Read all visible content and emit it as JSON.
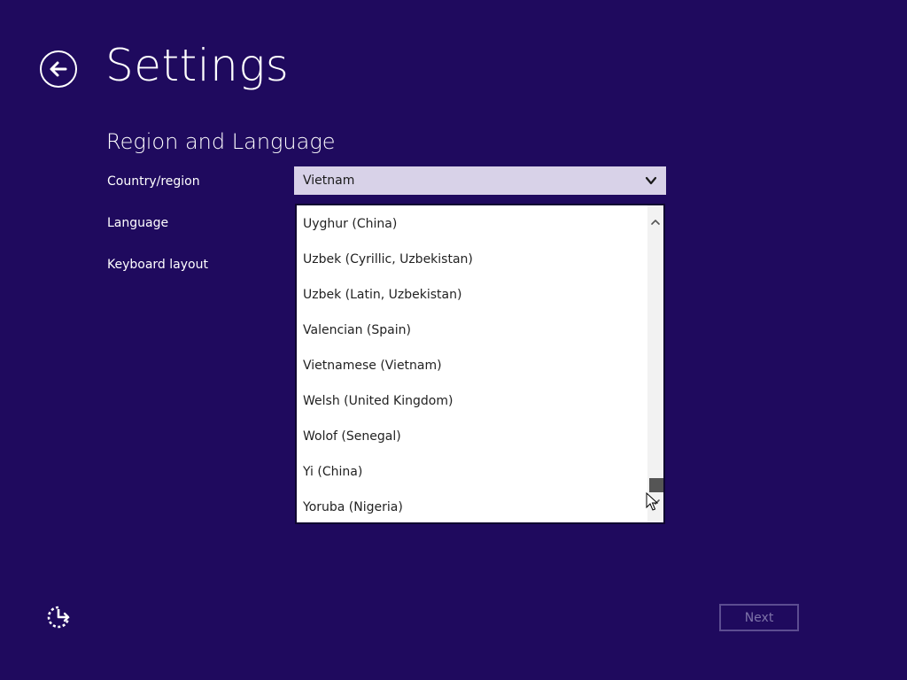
{
  "header": {
    "title": "Settings"
  },
  "section": {
    "title": "Region and Language"
  },
  "fields": {
    "country_label": "Country/region",
    "language_label": "Language",
    "keyboard_label": "Keyboard layout"
  },
  "country_select": {
    "value": "Vietnam"
  },
  "language_dropdown": {
    "options": [
      "Uyghur (China)",
      "Uzbek (Cyrillic, Uzbekistan)",
      "Uzbek (Latin, Uzbekistan)",
      "Valencian (Spain)",
      "Vietnamese (Vietnam)",
      "Welsh (United Kingdom)",
      "Wolof (Senegal)",
      "Yi (China)",
      "Yoruba (Nigeria)"
    ]
  },
  "footer": {
    "next_label": "Next"
  },
  "colors": {
    "background": "#1f0a5e",
    "select_background": "#d8d2e8",
    "next_border": "#5c4d91",
    "next_text": "#7d72a8"
  },
  "icons": {
    "back": "arrow-left-circle-icon",
    "ease_of_access": "ease-of-access-icon",
    "dropdown": "chevron-down-icon"
  }
}
